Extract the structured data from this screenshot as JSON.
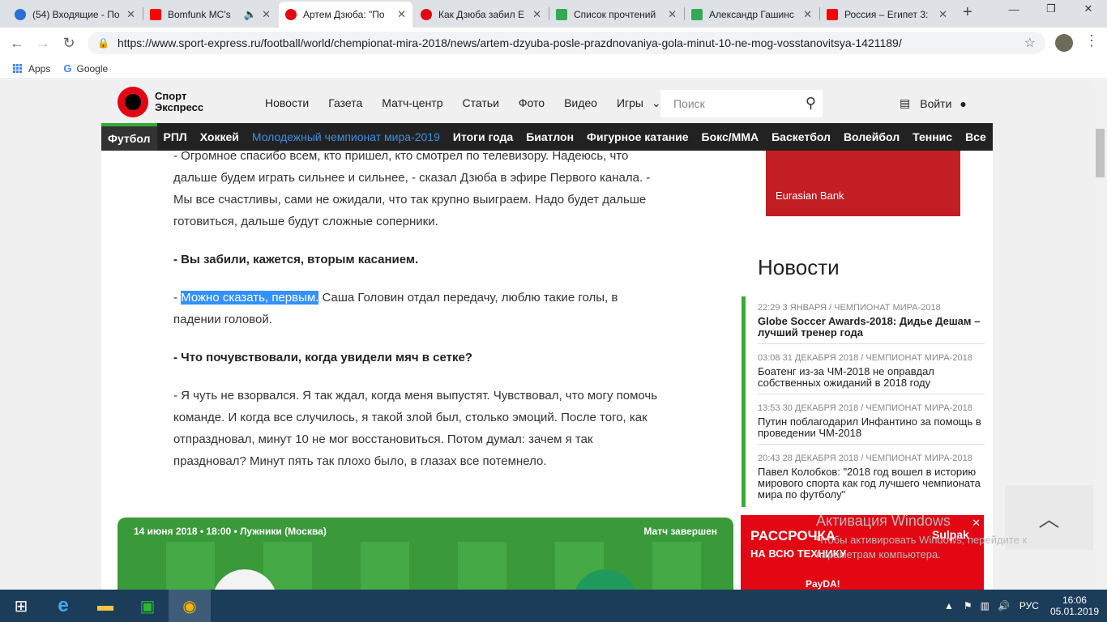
{
  "browser": {
    "tabs": [
      {
        "title": "(54) Входящие - По",
        "color": "#2a6fd6"
      },
      {
        "title": "Bomfunk MC's",
        "color": "#ff0000"
      },
      {
        "title": "Артем Дзюба: \"По",
        "color": "#e30613"
      },
      {
        "title": "Как Дзюба забил Е",
        "color": "#e30613"
      },
      {
        "title": "Список прочтений",
        "color": "#34a853"
      },
      {
        "title": "Александр Гашинс",
        "color": "#34a853"
      },
      {
        "title": "Россия – Египет 3:",
        "color": "#ff0000"
      }
    ],
    "url": "https://www.sport-express.ru/football/world/chempionat-mira-2018/news/artem-dzyuba-posle-prazdnovaniya-gola-minut-10-ne-mog-vosstanovitsya-1421189/",
    "bookmarks": [
      "Apps",
      "Google"
    ]
  },
  "site": {
    "logo_line1": "Спорт",
    "logo_line2": "Экспресс",
    "nav": [
      "Новости",
      "Газета",
      "Матч-центр",
      "Статьи",
      "Фото",
      "Видео",
      "Игры"
    ],
    "search_placeholder": "Поиск",
    "login": "Войти",
    "categories": [
      "Футбол",
      "РПЛ",
      "Хоккей",
      "Молодежный чемпионат мира-2019",
      "Итоги года",
      "Биатлон",
      "Фигурное катание",
      "Бокс/ММА",
      "Баскетбол",
      "Волейбол",
      "Теннис",
      "Все"
    ]
  },
  "article": {
    "p1": "- Огромное спасибо всем, кто пришел, кто смотрел по телевизору. Надеюсь, что дальше будем играть сильнее и сильнее, - сказал Дзюба в эфире Первого канала. - Мы все счастливы, сами не ожидали, что так крупно выиграем. Надо будет дальше готовиться, дальше будут сложные соперники.",
    "q1": "- Вы забили, кажется, вторым касанием.",
    "a1_dash": "- ",
    "a1_sel": "Можно сказать, первым.",
    "a1_rest": " Саша Головин отдал передачу, люблю такие голы, в падении головой.",
    "q2": "- Что почувствовали, когда увидели мяч в сетке?",
    "a2": "- Я чуть не взорвался. Я так ждал, когда меня выпустят. Чувствовал, что могу помочь команде. И когда все случилось, я такой злой был, столько эмоций. После того, как отпраздновал, минут 10 не мог восстановиться. Потом думал: зачем я так праздновал? Минут пять так плохо было, в глазах все потемнело."
  },
  "match": {
    "info": "14 июня 2018 • 18:00 • Лужники (Москва)",
    "status": "Матч завершен"
  },
  "ad_top": {
    "bank": "Eurasian Bank"
  },
  "news": {
    "heading": "Новости",
    "items": [
      {
        "meta": "22:29 3 января / Чемпионат мира-2018",
        "title": "Globe Soccer Awards-2018: Дидье Дешам – лучший тренер года"
      },
      {
        "meta": "03:08 31 декабря 2018 / Чемпионат мира-2018",
        "title": "Боатенг из-за ЧМ-2018 не оправдал собственных ожиданий в 2018 году"
      },
      {
        "meta": "13:53 30 декабря 2018 / Чемпионат мира-2018",
        "title": "Путин поблагодарил Инфантино за помощь в проведении ЧМ-2018"
      },
      {
        "meta": "20:43 28 декабря 2018 / Чемпионат мира-2018",
        "title": "Павел Колобков: \"2018 год вошел в историю мирового спорта как год лучшего чемпионата мира по футболу\""
      }
    ]
  },
  "ad_bottom": {
    "line1": "РАССРОЧКА",
    "line2": "НА ВСЮ ТЕХНИКУ",
    "brand": "Sulpak",
    "pay": "PayDA!"
  },
  "watermark": {
    "line1": "Активация Windows",
    "line2": "Чтобы активировать Windows, перейдите к параметрам компьютера."
  },
  "taskbar": {
    "lang": "РУС",
    "time": "16:06",
    "date": "05.01.2019"
  }
}
